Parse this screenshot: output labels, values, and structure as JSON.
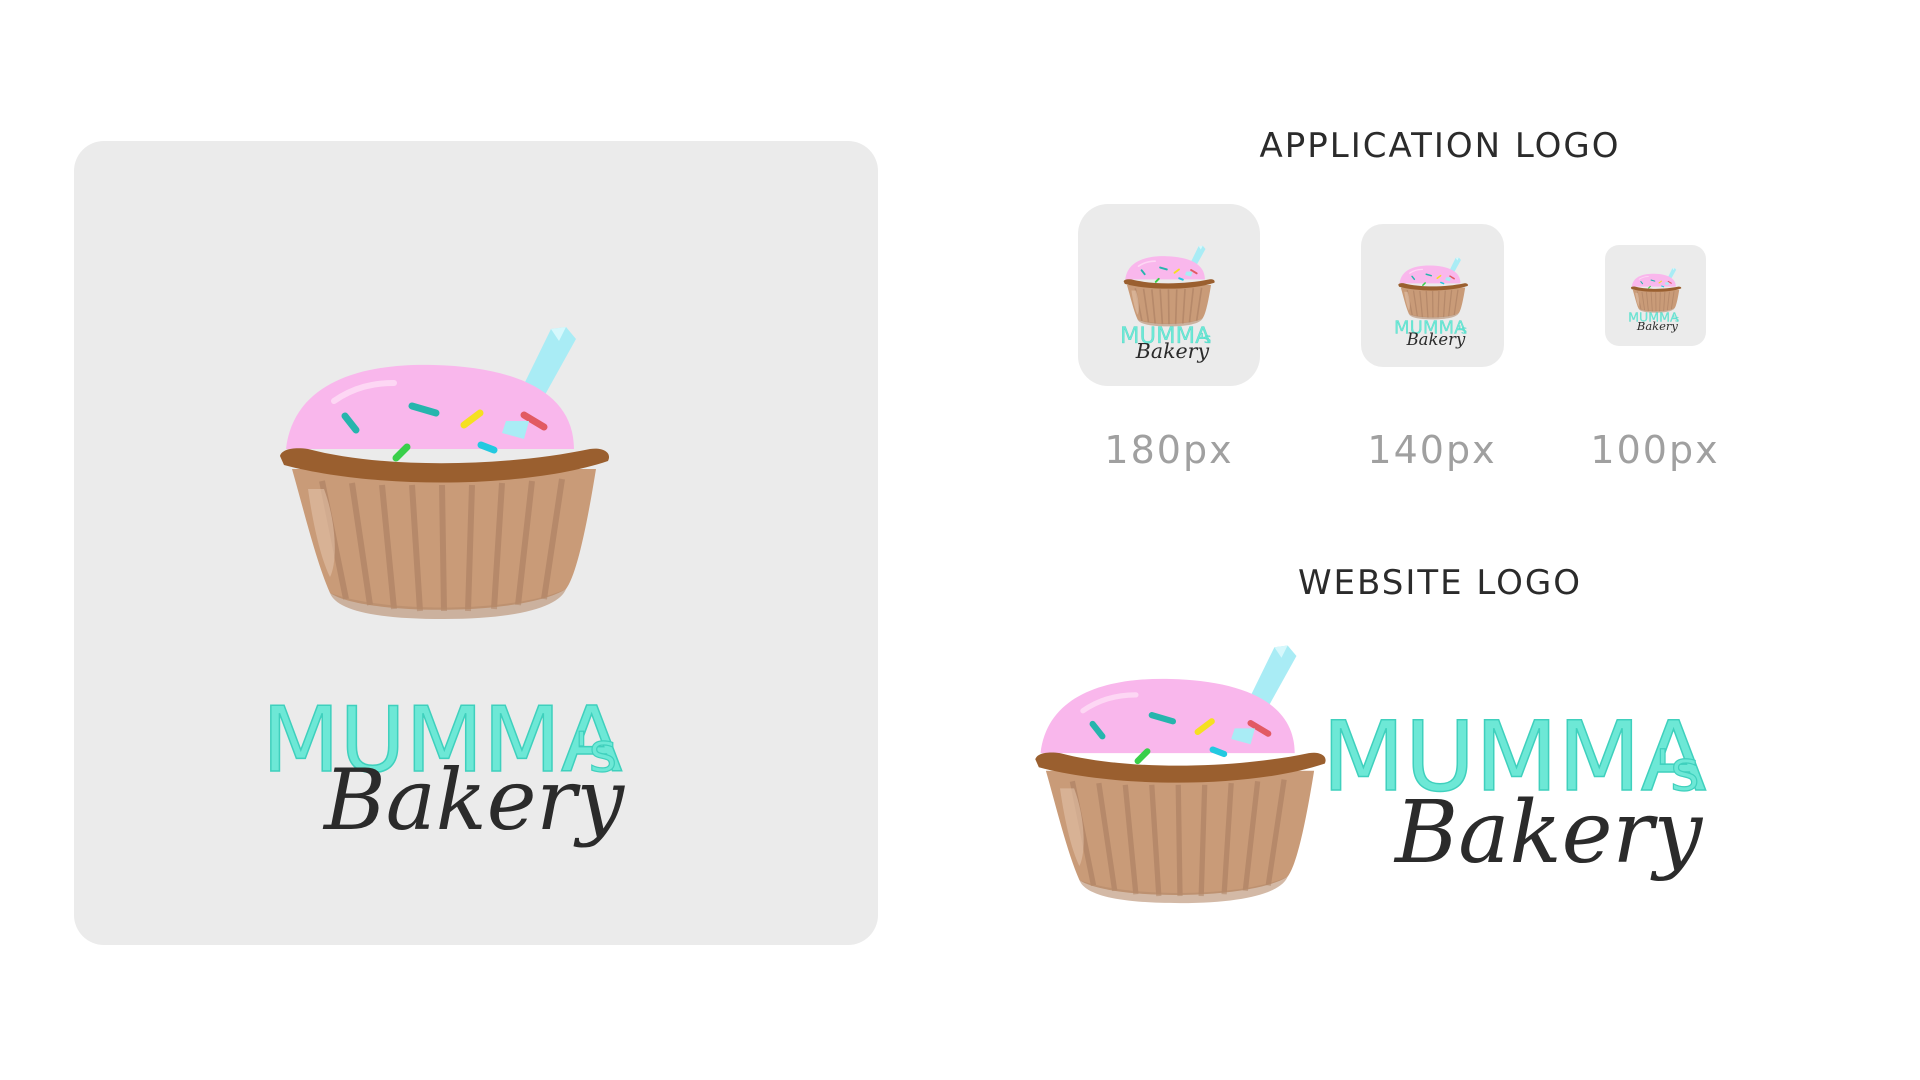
{
  "brand": {
    "name": "MUMMA's",
    "name_main": "MUMMA",
    "name_suffix": "'s",
    "subtitle": "Bakery"
  },
  "sections": {
    "application_logo": "APPLICATION LOGO",
    "website_logo": "WEBSITE LOGO"
  },
  "app_icons": [
    {
      "label": "180px"
    },
    {
      "label": "140px"
    },
    {
      "label": "100px"
    }
  ],
  "colors": {
    "tile_background": "#ebebeb",
    "frosting": "#f9b7ec",
    "cup": "#c99b78",
    "cup_rim": "#9a5f2f",
    "brand_text": "#6de8d6",
    "script_text": "#2b2b2b",
    "spoon": "#a9ecf5",
    "sprinkles": [
      "#26b5ad",
      "#26b5ad",
      "#f5e021",
      "#e25a63",
      "#39cf4a",
      "#23c9e0"
    ]
  }
}
